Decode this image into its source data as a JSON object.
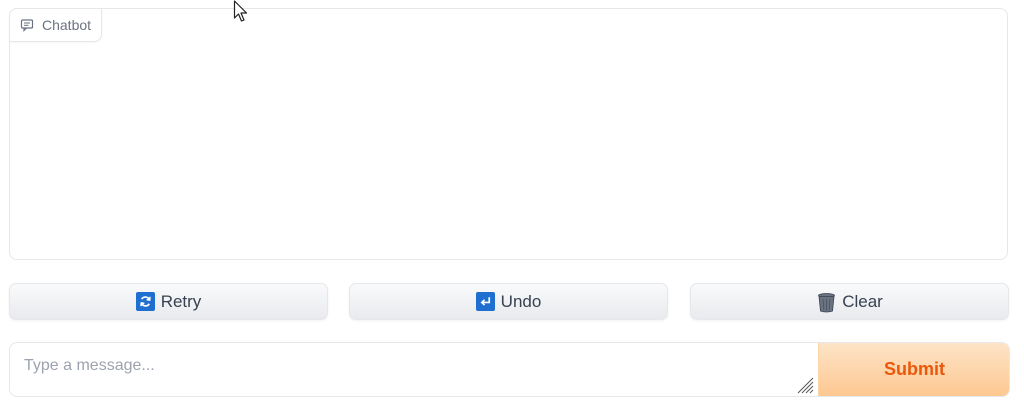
{
  "chatbot": {
    "label": "Chatbot",
    "icon": "chat-bubble-icon"
  },
  "buttons": {
    "retry": {
      "label": "Retry",
      "icon": "refresh-icon"
    },
    "undo": {
      "label": "Undo",
      "icon": "undo-arrow-icon"
    },
    "clear": {
      "label": "Clear",
      "icon": "trash-icon"
    }
  },
  "input": {
    "placeholder": "Type a message...",
    "value": ""
  },
  "submit": {
    "label": "Submit"
  },
  "colors": {
    "accent": "#ea580c",
    "submit_bg": "#fdc891",
    "button_bg": "#eceef1",
    "border": "#e5e7eb"
  }
}
